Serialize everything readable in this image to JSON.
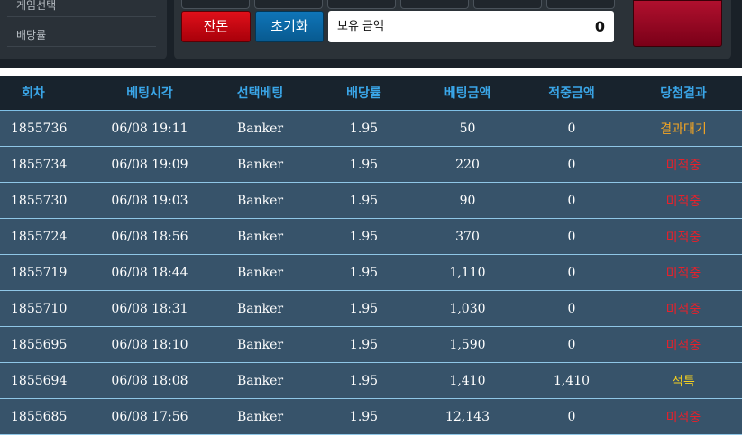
{
  "menu": {
    "items": [
      "게임선택",
      "배당률"
    ]
  },
  "controls": {
    "red_button": "잔돈",
    "reset_button": "초기화",
    "balance_label": "보유 금액",
    "balance_value": "0"
  },
  "colors": {
    "header_text": "#3aa6e8",
    "row_bg": "#37536a",
    "wait": "#f5a623",
    "miss": "#e8202a",
    "hit": "#f5d020"
  },
  "table": {
    "headers": [
      "회차",
      "베팅시각",
      "선택베팅",
      "배당률",
      "베팅금액",
      "적중금액",
      "당첨결과"
    ],
    "rows": [
      {
        "round": "1855736",
        "time": "06/08 19:11",
        "choice": "Banker",
        "odds": "1.95",
        "amount": "50",
        "win": "0",
        "result": "결과대기",
        "status": "wait"
      },
      {
        "round": "1855734",
        "time": "06/08 19:09",
        "choice": "Banker",
        "odds": "1.95",
        "amount": "220",
        "win": "0",
        "result": "미적중",
        "status": "miss"
      },
      {
        "round": "1855730",
        "time": "06/08 19:03",
        "choice": "Banker",
        "odds": "1.95",
        "amount": "90",
        "win": "0",
        "result": "미적중",
        "status": "miss"
      },
      {
        "round": "1855724",
        "time": "06/08 18:56",
        "choice": "Banker",
        "odds": "1.95",
        "amount": "370",
        "win": "0",
        "result": "미적중",
        "status": "miss"
      },
      {
        "round": "1855719",
        "time": "06/08 18:44",
        "choice": "Banker",
        "odds": "1.95",
        "amount": "1,110",
        "win": "0",
        "result": "미적중",
        "status": "miss"
      },
      {
        "round": "1855710",
        "time": "06/08 18:31",
        "choice": "Banker",
        "odds": "1.95",
        "amount": "1,030",
        "win": "0",
        "result": "미적중",
        "status": "miss"
      },
      {
        "round": "1855695",
        "time": "06/08 18:10",
        "choice": "Banker",
        "odds": "1.95",
        "amount": "1,590",
        "win": "0",
        "result": "미적중",
        "status": "miss"
      },
      {
        "round": "1855694",
        "time": "06/08 18:08",
        "choice": "Banker",
        "odds": "1.95",
        "amount": "1,410",
        "win": "1,410",
        "result": "적특",
        "status": "hit"
      },
      {
        "round": "1855685",
        "time": "06/08 17:56",
        "choice": "Banker",
        "odds": "1.95",
        "amount": "12,143",
        "win": "0",
        "result": "미적중",
        "status": "miss"
      }
    ]
  }
}
